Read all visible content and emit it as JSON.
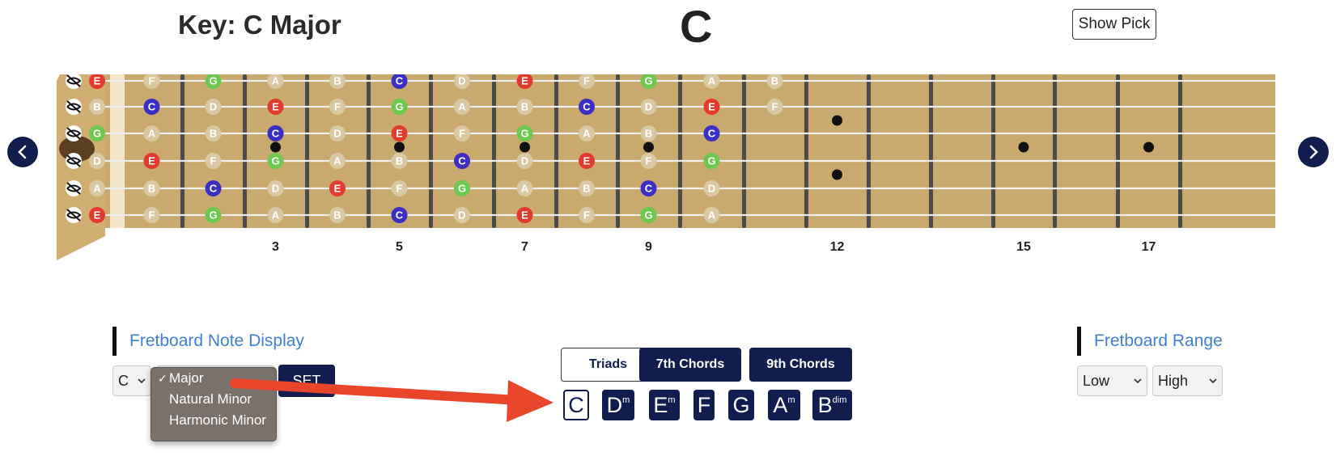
{
  "header": {
    "key_title": "Key: C Major",
    "chord_title": "C",
    "show_pick_label": "Show Pick"
  },
  "fretboard": {
    "fret_numbers": [
      "3",
      "5",
      "7",
      "9",
      "12",
      "15",
      "17"
    ],
    "colors": {
      "E": "#e23a2e",
      "G": "#6cc84e",
      "C": "#3b2fc4",
      "ghost": "#d9c8a2"
    },
    "strings": [
      {
        "open": "E",
        "notes": [
          "F",
          "G",
          "A",
          "B",
          "C",
          "D",
          "E",
          "F",
          "G",
          "A",
          "B"
        ]
      },
      {
        "open": "B",
        "notes": [
          "C",
          "D",
          "E",
          "F",
          "G",
          "A",
          "B",
          "C",
          "D",
          "E",
          "F"
        ]
      },
      {
        "open": "G",
        "notes": [
          "A",
          "B",
          "C",
          "D",
          "E",
          "F",
          "G",
          "A",
          "B",
          "C"
        ]
      },
      {
        "open": "D",
        "notes": [
          "E",
          "F",
          "G",
          "A",
          "B",
          "C",
          "D",
          "E",
          "F",
          "G"
        ]
      },
      {
        "open": "A",
        "notes": [
          "B",
          "C",
          "D",
          "E",
          "F",
          "G",
          "A",
          "B",
          "C",
          "D"
        ]
      },
      {
        "open": "E",
        "notes": [
          "F",
          "G",
          "A",
          "B",
          "C",
          "D",
          "E",
          "F",
          "G",
          "A"
        ]
      }
    ]
  },
  "note_display": {
    "section_label": "Fretboard Note Display",
    "root_value": "C",
    "scale_options": [
      "Major",
      "Natural Minor",
      "Harmonic Minor"
    ],
    "selected_scale": "Major",
    "set_label": "SET"
  },
  "chord_tabs": [
    "Triads",
    "7th Chords",
    "9th Chords"
  ],
  "chords": [
    {
      "base": "C",
      "suffix": "",
      "active": true
    },
    {
      "base": "D",
      "suffix": "m",
      "active": false
    },
    {
      "base": "E",
      "suffix": "m",
      "active": false
    },
    {
      "base": "F",
      "suffix": "",
      "active": false
    },
    {
      "base": "G",
      "suffix": "",
      "active": false
    },
    {
      "base": "A",
      "suffix": "m",
      "active": false
    },
    {
      "base": "B",
      "suffix": "dim",
      "active": false
    }
  ],
  "range": {
    "section_label": "Fretboard Range",
    "low_value": "Low",
    "high_value": "High"
  }
}
